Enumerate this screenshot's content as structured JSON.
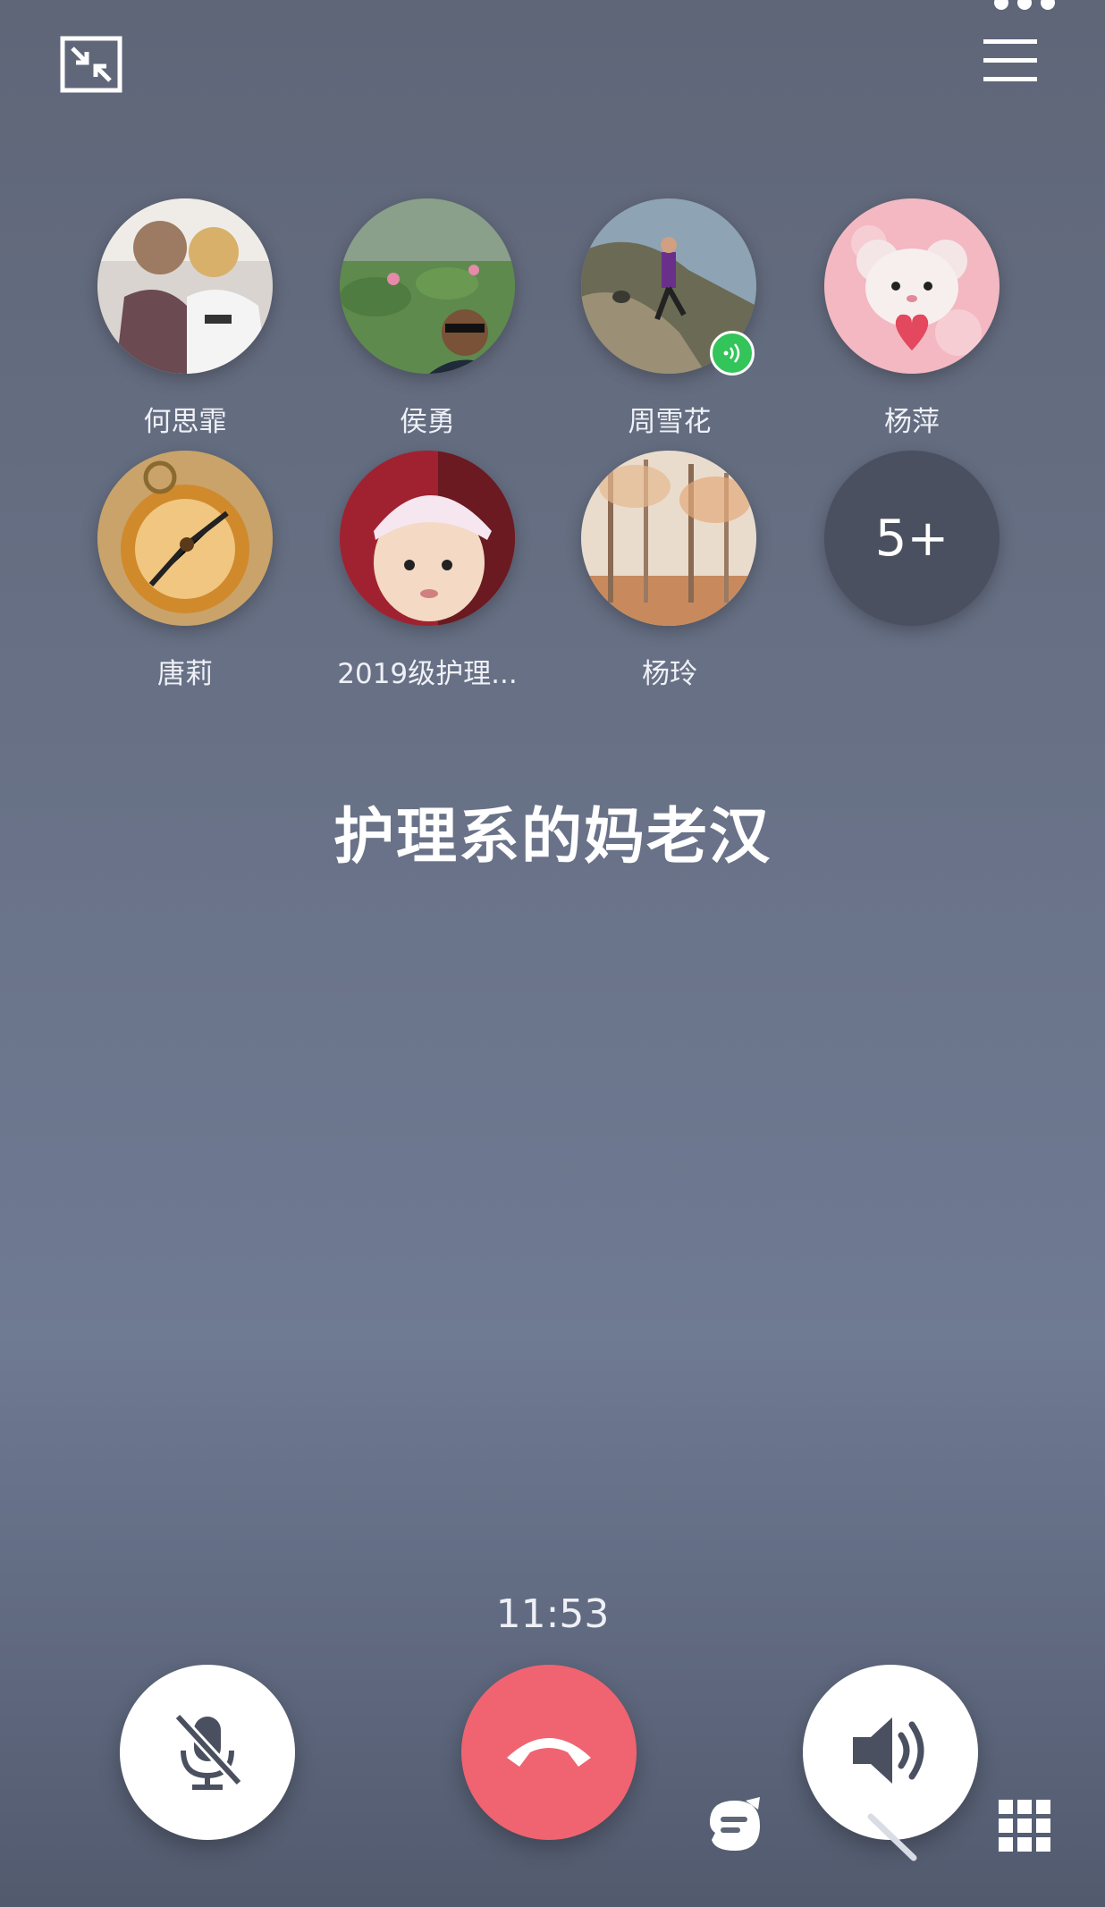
{
  "header": {
    "minimize_icon": "minimize-icon",
    "menu_icon": "menu-icon",
    "overflow_icon": "more-dots-icon"
  },
  "participants": [
    {
      "name": "何思霏",
      "speaking": false
    },
    {
      "name": "侯勇",
      "speaking": false
    },
    {
      "name": "周雪花",
      "speaking": true
    },
    {
      "name": "杨萍",
      "speaking": false
    },
    {
      "name": "唐莉",
      "speaking": false
    },
    {
      "name": "2019级护理...",
      "speaking": false
    },
    {
      "name": "杨玲",
      "speaking": false
    }
  ],
  "more_count": "5+",
  "group_name": "护理系的妈老汉",
  "call": {
    "duration": "11:53"
  },
  "controls": {
    "mute_icon": "microphone-muted-icon",
    "hangup_icon": "phone-hangup-icon",
    "speaker_icon": "speaker-icon",
    "chat_icon": "chat-bubble-icon",
    "effects_icon": "magic-wand-icon",
    "keypad_icon": "keypad-grid-icon"
  },
  "colors": {
    "hangup": "#ef6470",
    "speaking_badge": "#33c45a",
    "more_circle": "#4a505f"
  }
}
